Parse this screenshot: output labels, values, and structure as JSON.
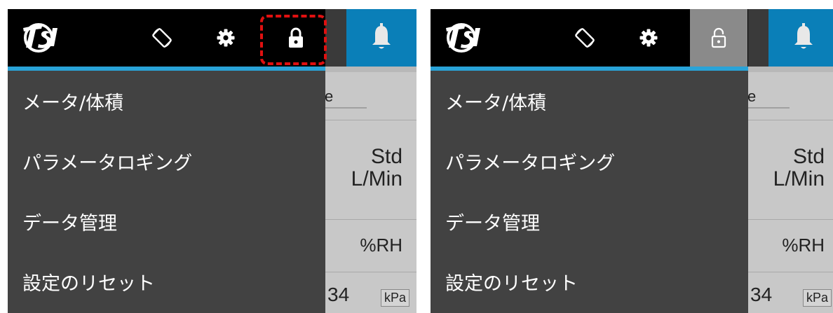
{
  "panels": [
    {
      "id": "left",
      "lock_state": "locked",
      "highlight": true,
      "menu": [
        "メータ/体積",
        "パラメータロギング",
        "データ管理",
        "設定のリセット"
      ],
      "background": {
        "col_fragment": "e",
        "unit_top": "Std",
        "unit_bottom": "L/Min",
        "unit_rh": "%RH",
        "value_fragment": "34",
        "unit_pressure": "kPa"
      }
    },
    {
      "id": "right",
      "lock_state": "unlocked",
      "highlight": false,
      "menu": [
        "メータ/体積",
        "パラメータロギング",
        "データ管理",
        "設定のリセット"
      ],
      "background": {
        "col_fragment": "e",
        "unit_top": "Std",
        "unit_bottom": "L/Min",
        "unit_rh": "%RH",
        "value_fragment": "34",
        "unit_pressure": "kPa"
      }
    }
  ],
  "icons": {
    "logo": "tsi-logo",
    "rotate": "screen-rotation-icon",
    "settings": "gear-icon",
    "lock": "lock-icon",
    "notifications": "bell-icon"
  },
  "colors": {
    "top_bar": "#000000",
    "drawer": "#424242",
    "accent": "#29a3d8",
    "bell_block": "#0a7fb8",
    "highlight": "#e01010",
    "lock_active_bg": "#8a8a8a"
  }
}
